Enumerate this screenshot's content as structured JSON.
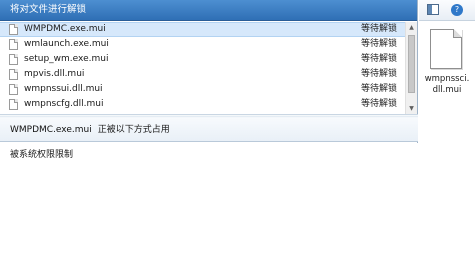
{
  "panel": {
    "title": "将对文件进行解锁"
  },
  "files": [
    {
      "name": "WMPDMC.exe.mui",
      "status": "等待解锁"
    },
    {
      "name": "wmlaunch.exe.mui",
      "status": "等待解锁"
    },
    {
      "name": "setup_wm.exe.mui",
      "status": "等待解锁"
    },
    {
      "name": "mpvis.dll.mui",
      "status": "等待解锁"
    },
    {
      "name": "wmpnssui.dll.mui",
      "status": "等待解锁"
    },
    {
      "name": "wmpnscfg.dll.mui",
      "status": "等待解锁"
    }
  ],
  "detail": {
    "file_name": "WMPDMC.exe.mui",
    "status_text": "正被以下方式占用",
    "reason": "被系统权限限制"
  },
  "preview": {
    "caption_line1": "wmpnssci.",
    "caption_line2": "dll.mui"
  },
  "icons": {
    "file": "document-icon",
    "preview_toggle": "preview-pane-icon",
    "help": "help-icon"
  }
}
